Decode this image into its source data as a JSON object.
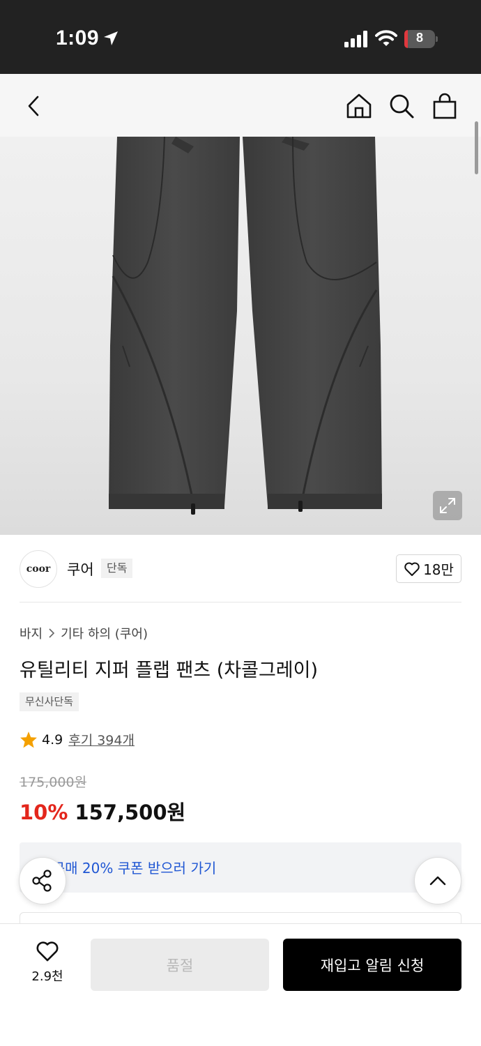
{
  "status_bar": {
    "time": "1:09",
    "battery": "8"
  },
  "header": {
    "icons": [
      "back-icon",
      "home-icon",
      "search-icon",
      "shopping-bag-icon"
    ]
  },
  "brand": {
    "logo_text": "coor",
    "name": "쿠어",
    "exclusive_tag": "단독",
    "like_count": "18만"
  },
  "product": {
    "breadcrumb": [
      "바지",
      "기타 하의 (쿠어)"
    ],
    "title": "유틸리티 지퍼 플랩 팬츠 (차콜그레이)",
    "store_tag": "무신사단독",
    "rating": "4.9",
    "reviews": "후기 394개",
    "original_price": "175,000원",
    "discount_rate": "10%",
    "sale_price": "157,500원"
  },
  "coupon": {
    "text": "첫 구매 20% 쿠폰 받으러 가기"
  },
  "bottom_bar": {
    "wish_count": "2.9천",
    "soldout_label": "품절",
    "restock_label": "재입고 알림 신청"
  },
  "colors": {
    "accent_red": "#e3261c",
    "link_blue": "#1f56d3",
    "primary_black": "#000000"
  }
}
